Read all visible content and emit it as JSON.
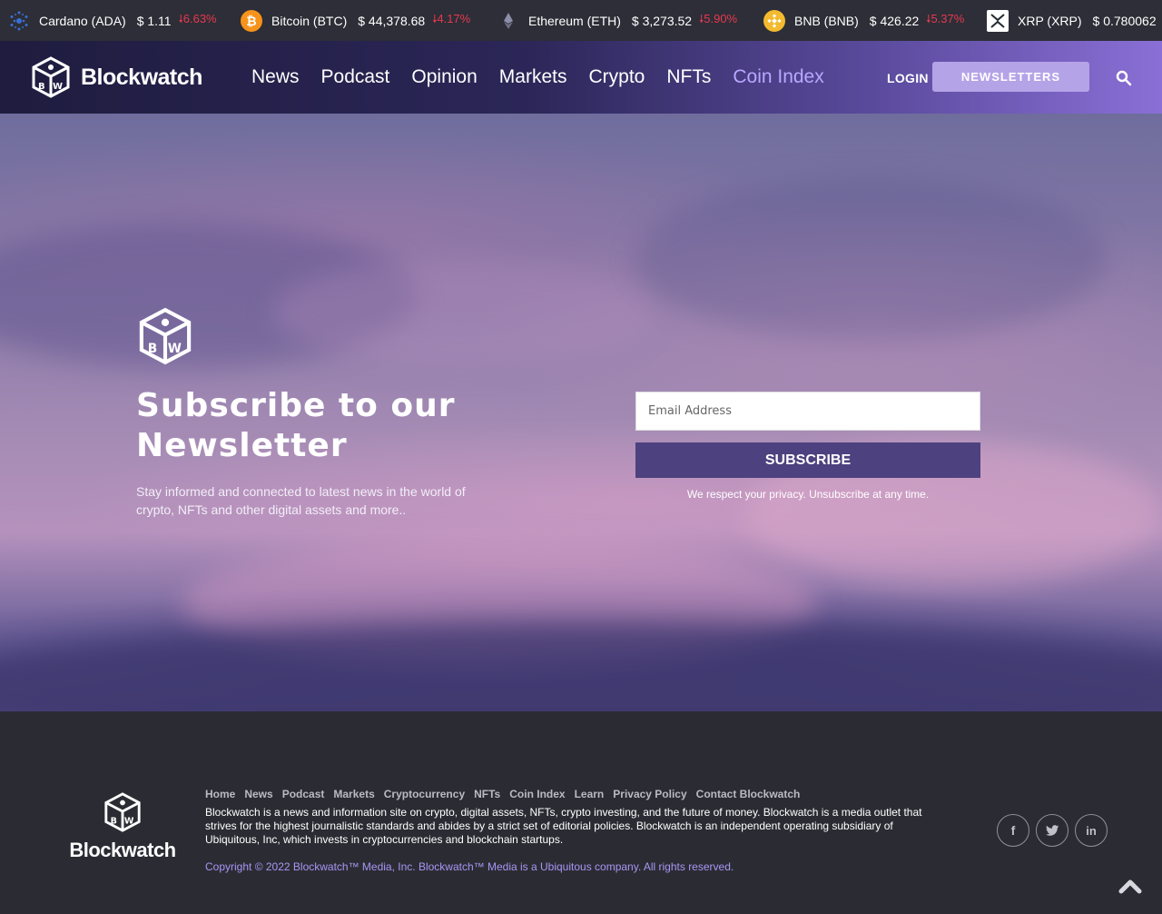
{
  "ticker": [
    {
      "name": "Cardano (ADA)",
      "price": "$ 1.11",
      "change": "6.63%",
      "icon": "cardano-icon"
    },
    {
      "name": "Bitcoin (BTC)",
      "price": "$ 44,378.68",
      "change": "4.17%",
      "icon": "bitcoin-icon"
    },
    {
      "name": "Ethereum (ETH)",
      "price": "$ 3,273.52",
      "change": "5.90%",
      "icon": "ethereum-icon"
    },
    {
      "name": "BNB (BNB)",
      "price": "$ 426.22",
      "change": "5.37%",
      "icon": "bnb-icon"
    },
    {
      "name": "XRP (XRP)",
      "price": "$ 0.780062",
      "change": "",
      "icon": "xrp-icon"
    }
  ],
  "nav": {
    "brand": "Blockwatch",
    "items": [
      "News",
      "Podcast",
      "Opinion",
      "Markets",
      "Crypto",
      "NFTs",
      "Coin Index"
    ],
    "login": "LOGIN",
    "newsletters": "NEWSLETTERS"
  },
  "hero": {
    "title_line1": "Subscribe to our",
    "title_line2": "Newsletter",
    "description": "Stay informed and connected to latest news in the world of crypto, NFTs and other digital assets and more..",
    "email_placeholder": "Email Address",
    "subscribe_label": "SUBSCRIBE",
    "privacy": "We respect your privacy. Unsubscribe at any time."
  },
  "footer": {
    "brand": "Blockwatch",
    "links": [
      "Home",
      "News",
      "Podcast",
      "Markets",
      "Cryptocurrency",
      "NFTs",
      "Coin Index",
      "Learn",
      "Privacy Policy",
      "Contact Blockwatch"
    ],
    "about": "Blockwatch is a news and information site on crypto, digital assets, NFTs, crypto investing, and the future of money. Blockwatch is a media outlet that strives for the highest journalistic standards and abides by a strict set of editorial policies. Blockwatch is an independent operating subsidiary of Ubiquitous, Inc, which invests in cryptocurrencies and blockchain startups.",
    "copyright": "Copyright © 2022 Blockwatch™ Media, Inc. Blockwatch™ Media is a Ubiquitous company. All rights reserved.",
    "social": [
      "facebook-icon",
      "twitter-icon",
      "linkedin-icon"
    ]
  },
  "colors": {
    "accent": "#b9a8ff",
    "negative": "#e8384f",
    "subscribe_button": "#4d417f",
    "newsletter_button": "#b5a3e8",
    "footer_bg": "#2b2c33"
  }
}
